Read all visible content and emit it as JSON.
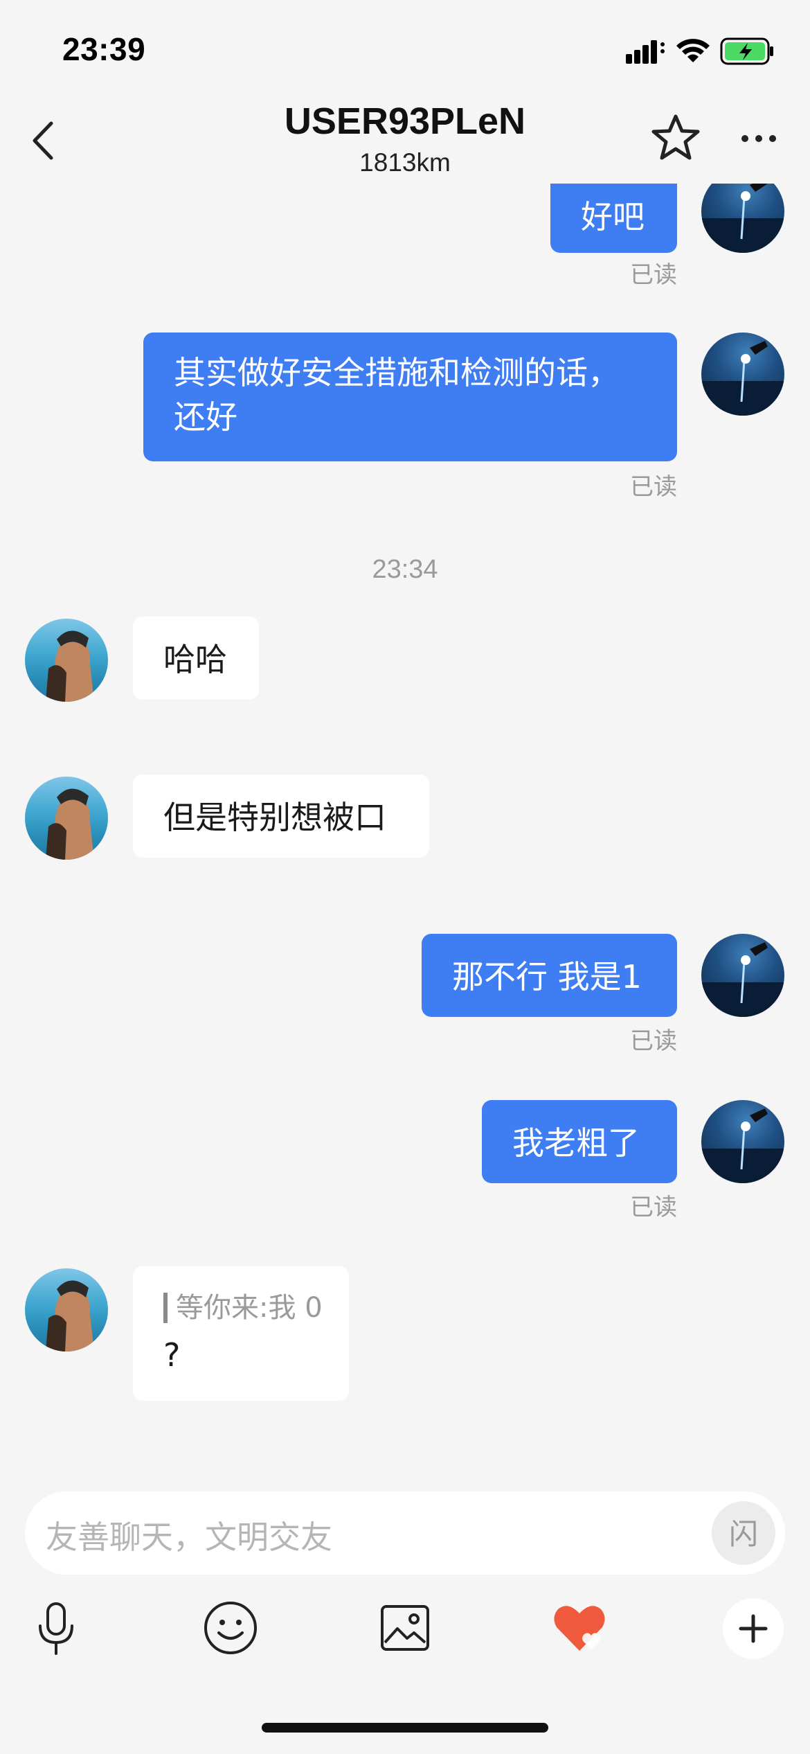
{
  "status_bar": {
    "time": "23:39"
  },
  "header": {
    "title": "USER93PLeN",
    "distance": "1813km"
  },
  "messages": [
    {
      "side": "out",
      "text": "好吧",
      "read": "已读"
    },
    {
      "side": "out",
      "text_line1": "其实做好安全措施和检测的话，",
      "text_line2": "还好",
      "read": "已读"
    },
    {
      "timestamp": "23:34"
    },
    {
      "side": "in",
      "text": "哈哈"
    },
    {
      "side": "in",
      "text": "但是特别想被口"
    },
    {
      "side": "out",
      "text": "那不行 我是1",
      "read": "已读"
    },
    {
      "side": "out",
      "text": "我老粗了",
      "read": "已读"
    },
    {
      "side": "in",
      "quote": "等你来:我 0",
      "text": "?"
    }
  ],
  "input": {
    "placeholder": "友善聊天，文明交友",
    "flash_label": "闪"
  },
  "toolbar": {
    "icons": [
      "microphone-icon",
      "emoji-icon",
      "image-icon",
      "heart-gift-icon",
      "plus-icon"
    ]
  },
  "colors": {
    "outgoing_bubble": "#3f7df3",
    "incoming_bubble": "#ffffff",
    "background": "#f5f5f5",
    "heart": "#f05a3c"
  }
}
